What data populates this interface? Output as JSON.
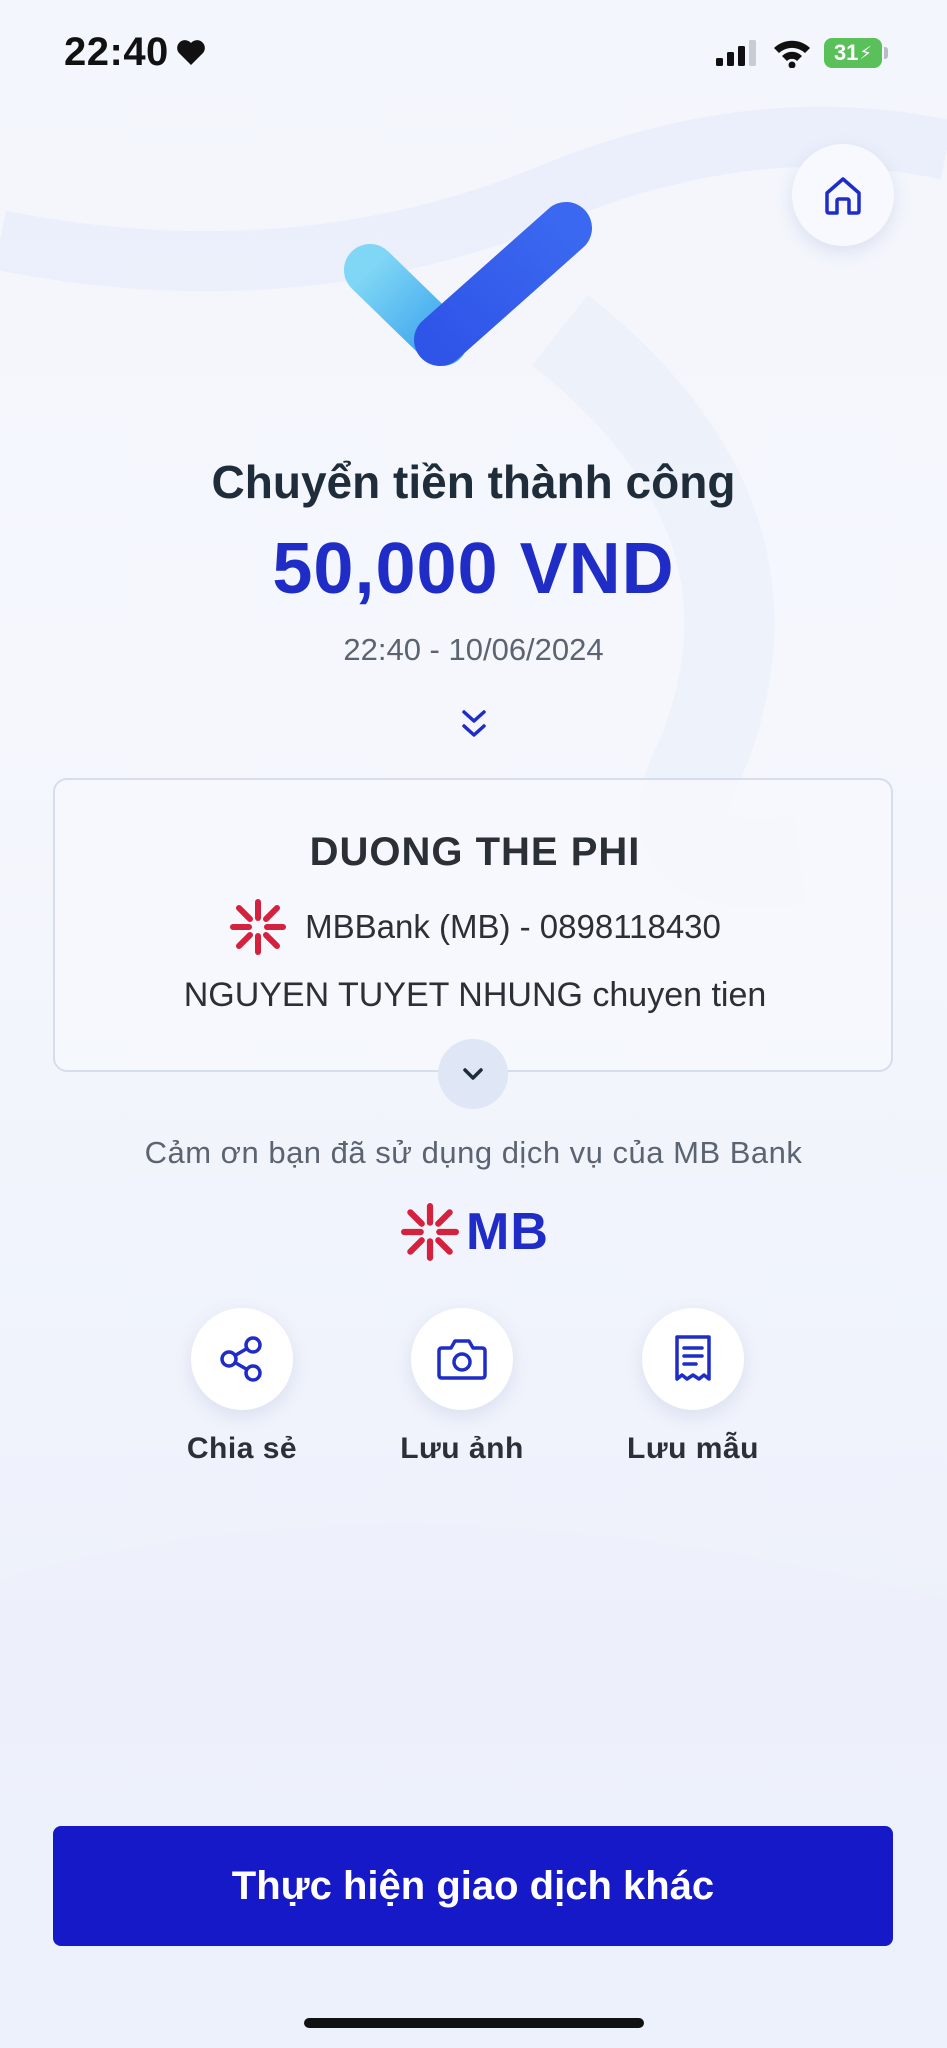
{
  "status_bar": {
    "time": "22:40",
    "battery": "31"
  },
  "icons": {
    "heart": "heart-icon",
    "signal": "cellular-signal-icon",
    "wifi": "wifi-icon",
    "battery": "battery-charging-icon",
    "home": "home-icon",
    "success": "checkmark-icon",
    "expand": "double-chevron-down-icon",
    "card_expand": "chevron-down-icon",
    "share": "share-icon",
    "camera": "camera-icon",
    "template": "receipt-icon"
  },
  "result": {
    "title": "Chuyển tiền thành công",
    "amount": "50,000 VND",
    "datetime": "22:40 - 10/06/2024"
  },
  "recipient": {
    "name": "DUONG THE PHI",
    "bank_account": "MBBank (MB) - 0898118430",
    "note": "NGUYEN TUYET NHUNG chuyen tien"
  },
  "thanks": "Cảm ơn bạn đã sử dụng dịch vụ của MB Bank",
  "brand": {
    "logo_text": "MB"
  },
  "actions": [
    {
      "label": "Chia sẻ"
    },
    {
      "label": "Lưu ảnh"
    },
    {
      "label": "Lưu mẫu"
    }
  ],
  "primary_button": {
    "label": "Thực hiện giao dịch khác"
  },
  "colors": {
    "primary": "#1619c8",
    "amount": "#1f2dc6",
    "brand_red": "#d4213d",
    "text_dark": "#1f2d3a"
  }
}
